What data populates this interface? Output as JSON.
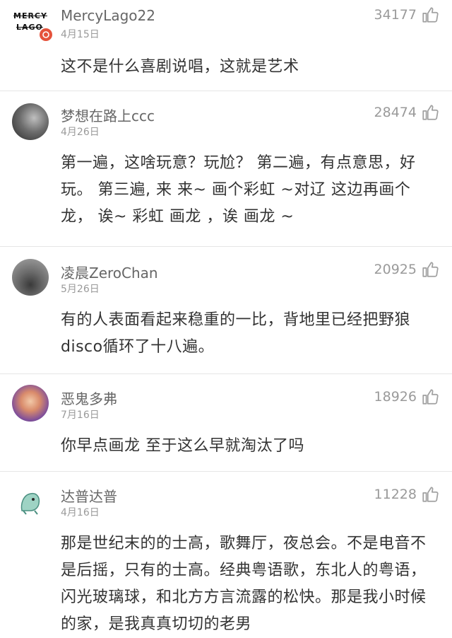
{
  "comments": [
    {
      "username": "MercyLago22",
      "date": "4月15日",
      "likes": "34177",
      "text": "这不是什么喜剧说唱，这就是艺术",
      "avatar_text_top": "MERCY",
      "avatar_text_bottom": "LAGO"
    },
    {
      "username": "梦想在路上ccc",
      "date": "4月26日",
      "likes": "28474",
      "text": "第一遍，这啥玩意？玩尬？ 第二遍，有点意思，好玩。 第三遍, 来 来~ 画个彩虹 ~对辽 这边再画个龙， 诶~ 彩虹 画龙 ，诶 画龙 ~"
    },
    {
      "username": "凌晨ZeroChan",
      "date": "5月26日",
      "likes": "20925",
      "text": "有的人表面看起来稳重的一比，背地里已经把野狼disco循环了十八遍。"
    },
    {
      "username": "恶鬼多弗",
      "date": "7月16日",
      "likes": "18926",
      "text": "你早点画龙 至于这么早就淘汰了吗"
    },
    {
      "username": "达普达普",
      "date": "4月16日",
      "likes": "11228",
      "text": "那是世纪末的的士高，歌舞厅，夜总会。不是电音不是后摇，只有的士高。经典粤语歌，东北人的粤语，闪光玻璃球，和北方方言流露的松快。那是我小时候的家，是我真真切切的老男"
    }
  ]
}
